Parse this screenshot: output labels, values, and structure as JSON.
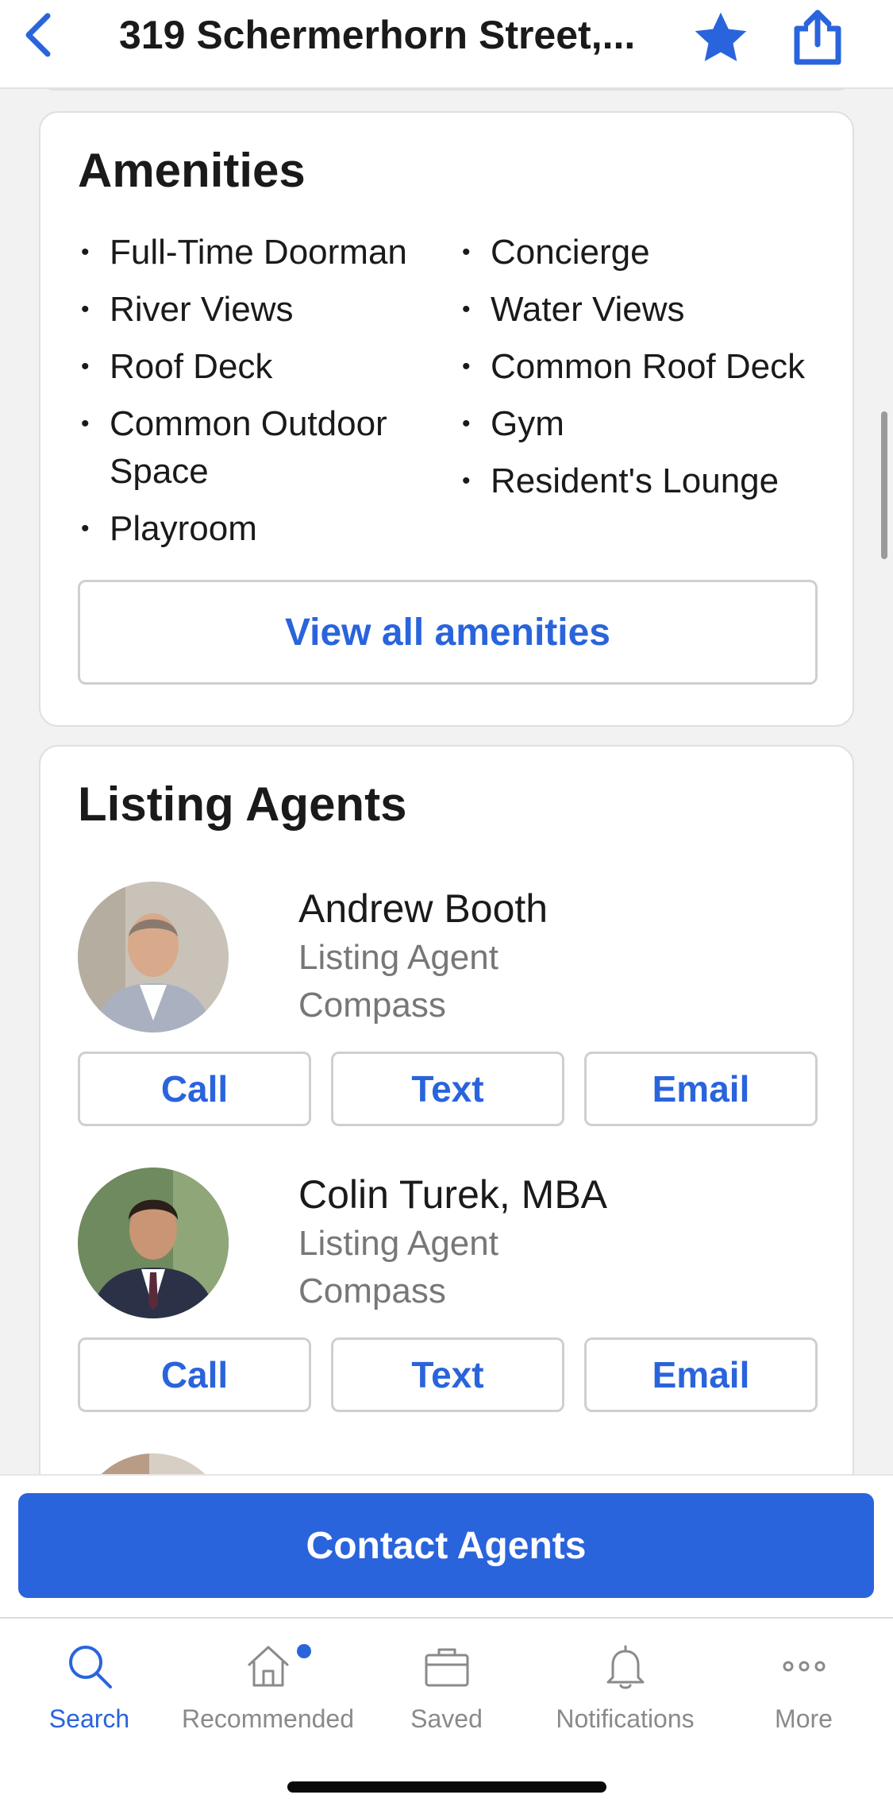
{
  "header": {
    "title": "319 Schermerhorn Street,...",
    "accent_color": "#2a64dc"
  },
  "amenities": {
    "title": "Amenities",
    "left_items": [
      "Full-Time Doorman",
      "River Views",
      "Roof Deck",
      "Common Outdoor Space",
      "Playroom"
    ],
    "right_items": [
      "Concierge",
      "Water Views",
      "Common Roof Deck",
      "Gym",
      "Resident's Lounge"
    ],
    "view_all_label": "View all amenities"
  },
  "listing_agents": {
    "title": "Listing Agents",
    "agents": [
      {
        "name": "Andrew Booth",
        "role": "Listing Agent",
        "company": "Compass",
        "call_label": "Call",
        "text_label": "Text",
        "email_label": "Email"
      },
      {
        "name": "Colin Turek, MBA",
        "role": "Listing Agent",
        "company": "Compass",
        "call_label": "Call",
        "text_label": "Text",
        "email_label": "Email"
      }
    ]
  },
  "cta": {
    "label": "Contact Agents"
  },
  "tabbar": {
    "tabs": [
      {
        "label": "Search",
        "icon": "search-icon",
        "active": true
      },
      {
        "label": "Recommended",
        "icon": "home-icon",
        "badge": true
      },
      {
        "label": "Saved",
        "icon": "folder-icon"
      },
      {
        "label": "Notifications",
        "icon": "bell-icon"
      },
      {
        "label": "More",
        "icon": "more-icon"
      }
    ]
  }
}
